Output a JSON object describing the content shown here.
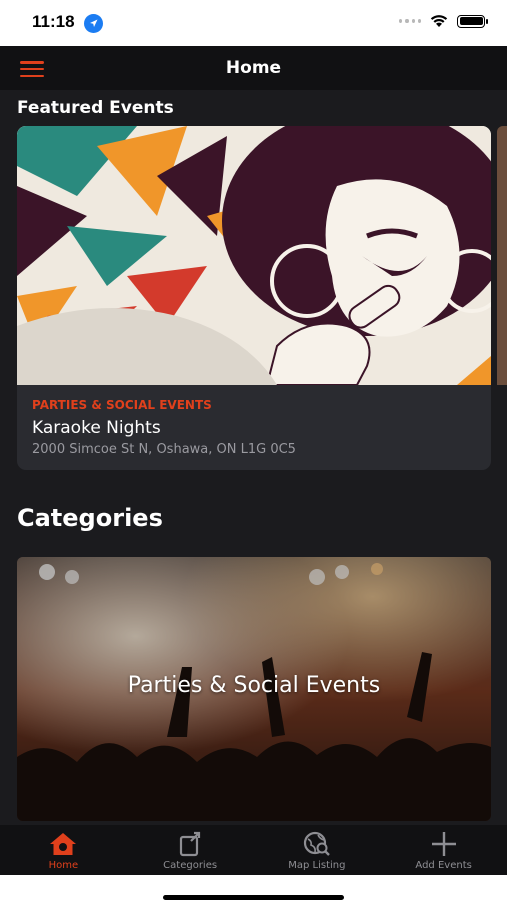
{
  "status_bar": {
    "time": "11:18"
  },
  "nav": {
    "title": "Home",
    "menu_icon": "hamburger-menu-icon"
  },
  "featured": {
    "heading": "Featured Events",
    "events": [
      {
        "category": "PARTIES & SOCIAL EVENTS",
        "title": "Karaoke Nights",
        "address": "2000 Simcoe St N, Oshawa, ON L1G 0C5"
      }
    ]
  },
  "categories": {
    "heading": "Categories",
    "items": [
      {
        "label": "Parties & Social Events"
      }
    ]
  },
  "tabs": [
    {
      "label": "Home",
      "icon": "home-icon",
      "active": true
    },
    {
      "label": "Categories",
      "icon": "categories-icon",
      "active": false
    },
    {
      "label": "Map Listing",
      "icon": "map-search-icon",
      "active": false
    },
    {
      "label": "Add Events",
      "icon": "plus-icon",
      "active": false
    }
  ],
  "colors": {
    "accent": "#e0401c",
    "background": "#1b1b1e",
    "card": "#2a2b30",
    "bar": "#111113"
  }
}
